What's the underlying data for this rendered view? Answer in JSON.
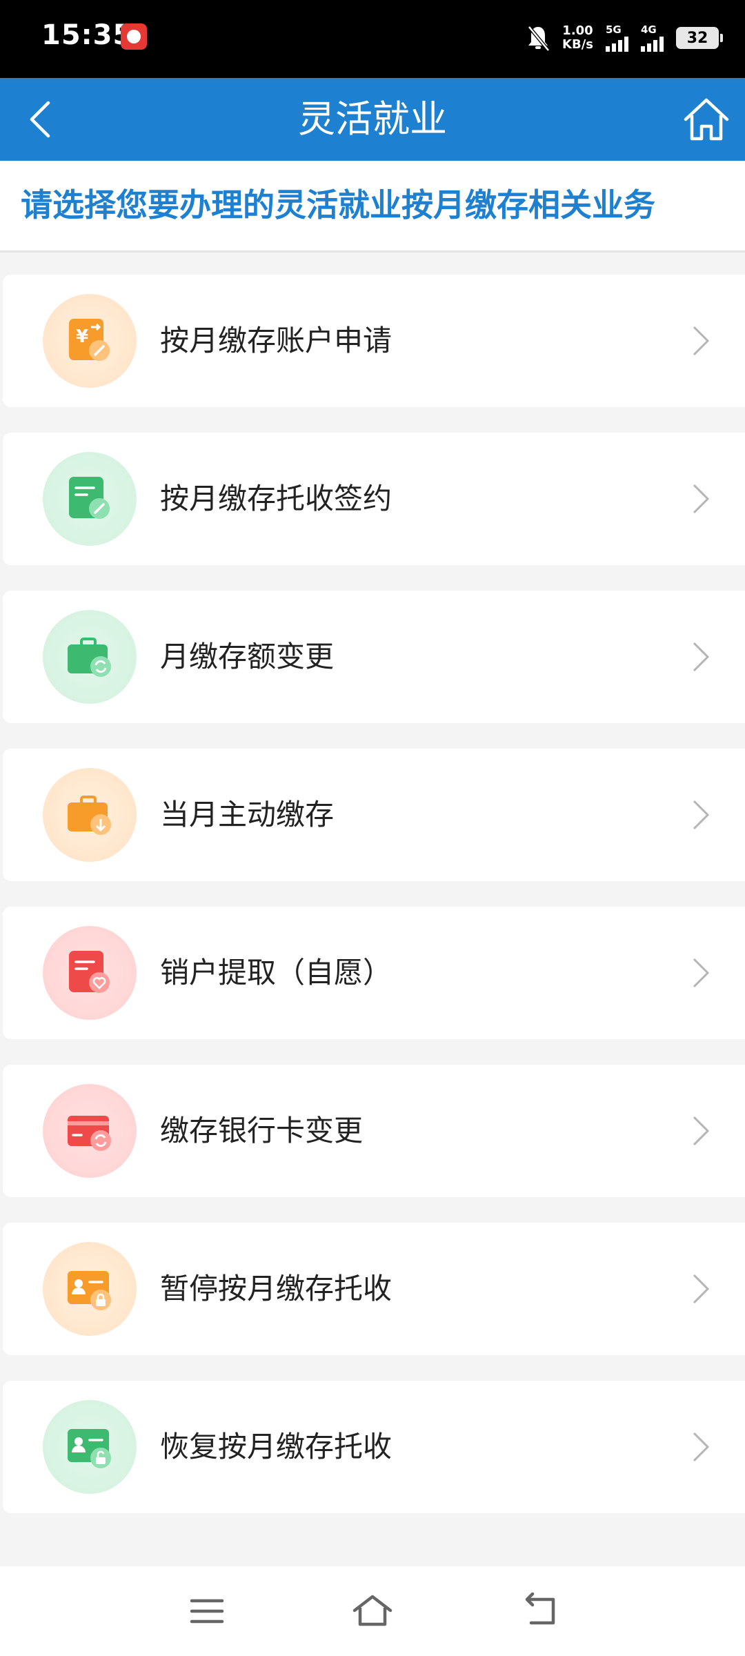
{
  "status_bar": {
    "time": "15:35",
    "speed_value": "1.00",
    "speed_unit": "KB/s",
    "sim1_tag": "5G",
    "sim2_tag": "4G",
    "battery": "32"
  },
  "header": {
    "title": "灵活就业",
    "back_icon": "chevron-left-icon",
    "home_icon": "home-icon"
  },
  "subtitle": "请选择您要办理的灵活就业按月缴存相关业务",
  "services": [
    {
      "label": "按月缴存账户申请",
      "icon": "yuan-edit-icon",
      "color": "#f79b2a"
    },
    {
      "label": "按月缴存托收签约",
      "icon": "document-sign-icon",
      "color": "#3dba6f"
    },
    {
      "label": "月缴存额变更",
      "icon": "briefcase-refresh-icon",
      "color": "#3dba6f"
    },
    {
      "label": "当月主动缴存",
      "icon": "briefcase-download-icon",
      "color": "#f79b2a"
    },
    {
      "label": "销户提取（自愿）",
      "icon": "document-heart-icon",
      "color": "#ef4a4a"
    },
    {
      "label": "缴存银行卡变更",
      "icon": "bank-card-refresh-icon",
      "color": "#ef4a4a"
    },
    {
      "label": "暂停按月缴存托收",
      "icon": "id-card-lock-icon",
      "color": "#f79b2a"
    },
    {
      "label": "恢复按月缴存托收",
      "icon": "id-card-unlock-icon",
      "color": "#3dba6f"
    }
  ],
  "nav": {
    "menu_icon": "menu-icon",
    "home_icon": "home-outline-icon",
    "back_icon": "back-arrow-icon"
  }
}
